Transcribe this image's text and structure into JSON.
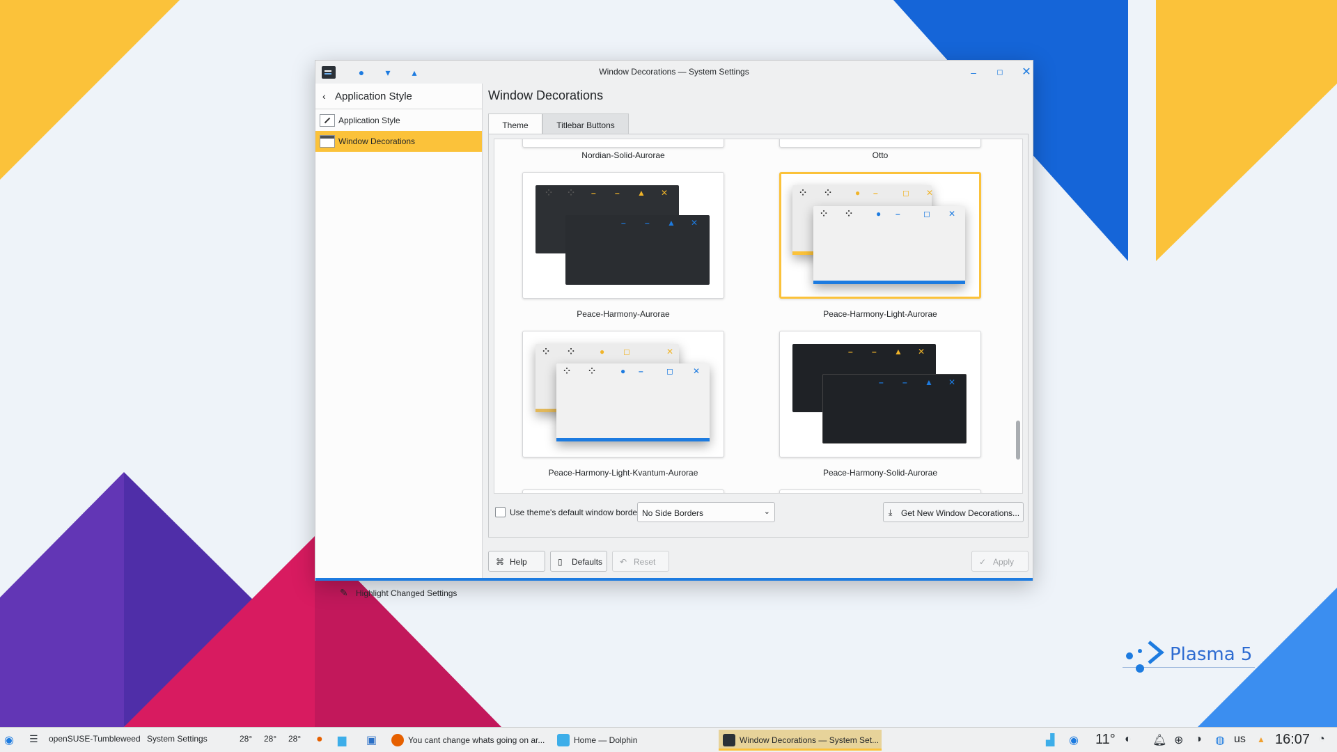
{
  "window": {
    "title": "Window Decorations — System Settings"
  },
  "sidebar": {
    "back_label": "Application Style",
    "items": [
      {
        "label": "Application Style",
        "selected": false
      },
      {
        "label": "Window Decorations",
        "selected": true
      }
    ],
    "highlight_label": "Highlight Changed Settings"
  },
  "page": {
    "title": "Window Decorations",
    "tabs": [
      {
        "label": "Theme",
        "active": true
      },
      {
        "label": "Titlebar Buttons",
        "active": false
      }
    ]
  },
  "themes": [
    {
      "name": "Nordian-Solid-Aurorae",
      "selected": false
    },
    {
      "name": "Otto",
      "selected": false
    },
    {
      "name": "Peace-Harmony-Aurorae",
      "selected": false
    },
    {
      "name": "Peace-Harmony-Light-Aurorae",
      "selected": true
    },
    {
      "name": "Peace-Harmony-Light-Kvantum-Aurorae",
      "selected": false
    },
    {
      "name": "Peace-Harmony-Solid-Aurorae",
      "selected": false
    }
  ],
  "options": {
    "border_checkbox_label": "Use theme's default window border size",
    "border_checkbox_checked": false,
    "border_size_value": "No Side Borders",
    "get_new_label": "Get New Window Decorations..."
  },
  "buttons": {
    "help": "Help",
    "defaults": "Defaults",
    "reset": "Reset",
    "apply": "Apply"
  },
  "taskbar": {
    "activity": "openSUSE-Tumbleweed",
    "app_label": "System Settings",
    "temps": [
      "28°",
      "28°",
      "28°"
    ],
    "tasks": [
      {
        "label": "You cant change whats going on ar...",
        "active": false
      },
      {
        "label": "Home — Dolphin",
        "active": false
      },
      {
        "label": "Window Decorations — System Set...",
        "active": true
      }
    ],
    "weather": "11°",
    "keyboard": "us",
    "clock": "16:07"
  },
  "desktop": {
    "logo_text": "Plasma 5"
  },
  "colors": {
    "accent": "#1d7be0",
    "highlight": "#fbc23a"
  }
}
